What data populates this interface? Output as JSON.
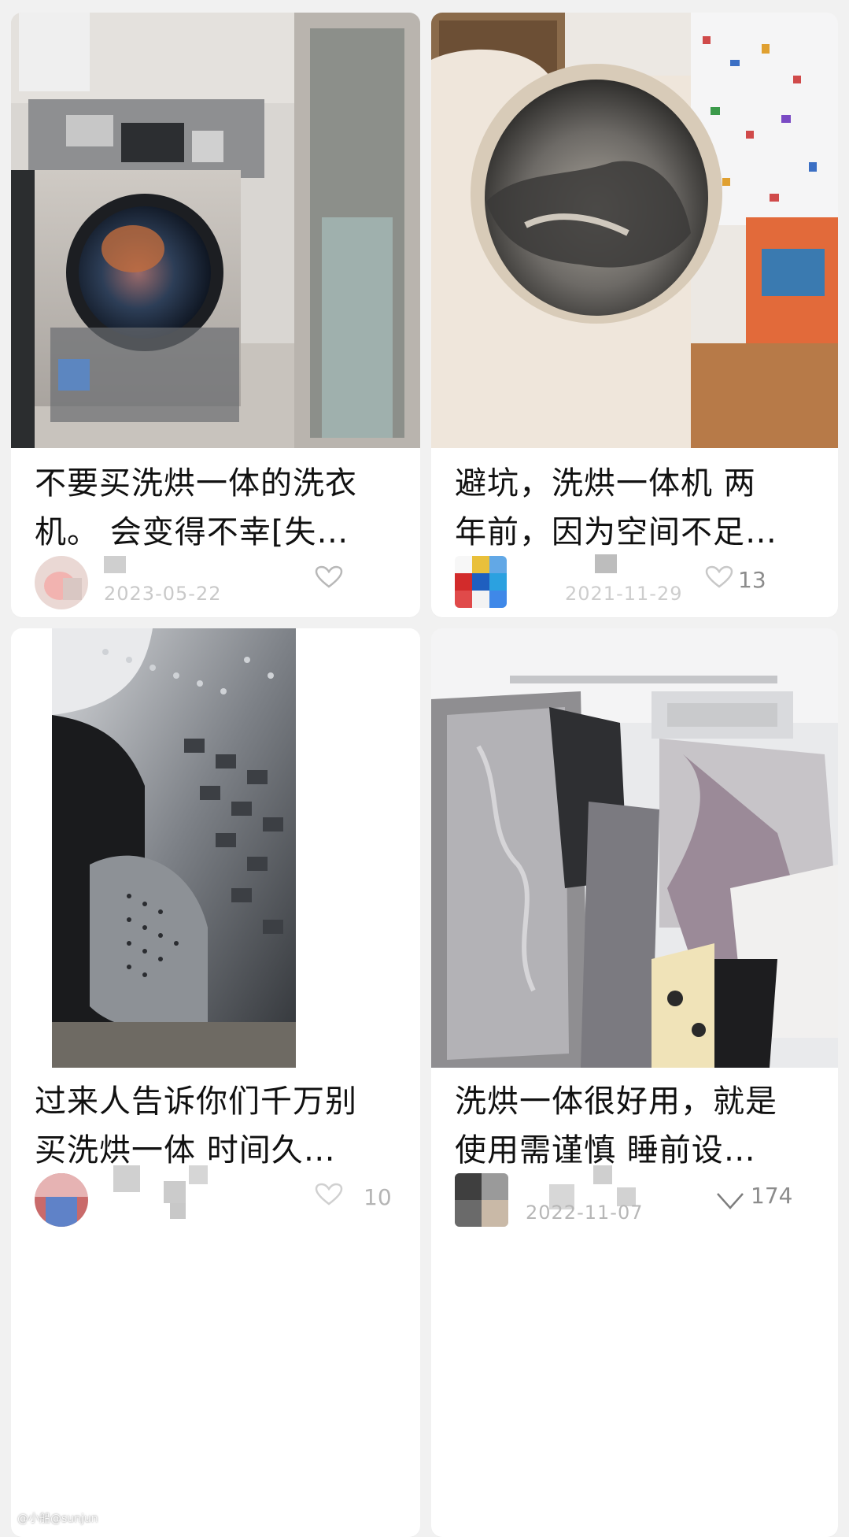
{
  "feed": {
    "cards": [
      {
        "title_line1": "不要买洗烘一体的洗衣",
        "title_line2": "机。 会变得不幸[失…",
        "date": "2023-05-22",
        "likes": ""
      },
      {
        "title_line1": "避坑，洗烘一体机 两",
        "title_line2": "年前，因为空间不足…",
        "date": "2021-11-29",
        "likes": "13"
      },
      {
        "title_line1": "过来人告诉你们千万别",
        "title_line2": "买洗烘一体 时间久…",
        "date": "",
        "likes": "10"
      },
      {
        "title_line1": "洗烘一体很好用，就是",
        "title_line2": "使用需谨慎 睡前设…",
        "date": "2022-11-07",
        "likes": "174"
      }
    ]
  },
  "watermark": "@小船@sunjun",
  "icons": {
    "like": "heart-outline-icon",
    "avatar": "avatar"
  },
  "colors": {
    "background": "#f1f1f1",
    "card": "#ffffff",
    "title": "#111111",
    "meta": "#9a9a9a"
  }
}
